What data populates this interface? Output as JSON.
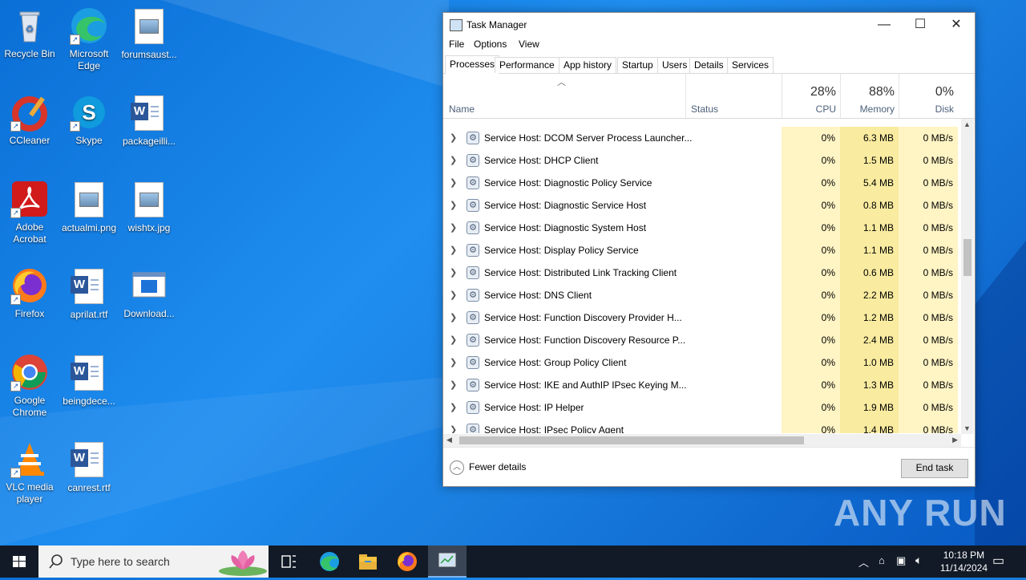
{
  "desktop": {
    "icons": [
      {
        "label": "Recycle Bin"
      },
      {
        "label": "Microsoft Edge"
      },
      {
        "label": "forumsaust..."
      },
      {
        "label": "CCleaner"
      },
      {
        "label": "Skype"
      },
      {
        "label": "packageilli..."
      },
      {
        "label": "Adobe Acrobat"
      },
      {
        "label": "actualmi.png"
      },
      {
        "label": "wishtx.jpg"
      },
      {
        "label": "Firefox"
      },
      {
        "label": "aprilat.rtf"
      },
      {
        "label": "Download..."
      },
      {
        "label": "Google Chrome"
      },
      {
        "label": "beingdece..."
      },
      {
        "label": "VLC media player"
      },
      {
        "label": "canrest.rtf"
      }
    ]
  },
  "taskmgr": {
    "title": "Task Manager",
    "menu": [
      "File",
      "Options",
      "View"
    ],
    "tabs": [
      "Processes",
      "Performance",
      "App history",
      "Startup",
      "Users",
      "Details",
      "Services"
    ],
    "active_tab": "Processes",
    "columns": {
      "name": "Name",
      "status": "Status",
      "cpu": {
        "pct": "28%",
        "label": "CPU"
      },
      "memory": {
        "pct": "88%",
        "label": "Memory"
      },
      "disk": {
        "pct": "0%",
        "label": "Disk"
      }
    },
    "rows": [
      {
        "name": "Service Host: DCOM Server Process Launcher...",
        "cpu": "0%",
        "mem": "6.3 MB",
        "disk": "0 MB/s"
      },
      {
        "name": "Service Host: DHCP Client",
        "cpu": "0%",
        "mem": "1.5 MB",
        "disk": "0 MB/s"
      },
      {
        "name": "Service Host: Diagnostic Policy Service",
        "cpu": "0%",
        "mem": "5.4 MB",
        "disk": "0 MB/s"
      },
      {
        "name": "Service Host: Diagnostic Service Host",
        "cpu": "0%",
        "mem": "0.8 MB",
        "disk": "0 MB/s"
      },
      {
        "name": "Service Host: Diagnostic System Host",
        "cpu": "0%",
        "mem": "1.1 MB",
        "disk": "0 MB/s"
      },
      {
        "name": "Service Host: Display Policy Service",
        "cpu": "0%",
        "mem": "1.1 MB",
        "disk": "0 MB/s"
      },
      {
        "name": "Service Host: Distributed Link Tracking Client",
        "cpu": "0%",
        "mem": "0.6 MB",
        "disk": "0 MB/s"
      },
      {
        "name": "Service Host: DNS Client",
        "cpu": "0%",
        "mem": "2.2 MB",
        "disk": "0 MB/s"
      },
      {
        "name": "Service Host: Function Discovery Provider H...",
        "cpu": "0%",
        "mem": "1.2 MB",
        "disk": "0 MB/s"
      },
      {
        "name": "Service Host: Function Discovery Resource P...",
        "cpu": "0%",
        "mem": "2.4 MB",
        "disk": "0 MB/s"
      },
      {
        "name": "Service Host: Group Policy Client",
        "cpu": "0%",
        "mem": "1.0 MB",
        "disk": "0 MB/s"
      },
      {
        "name": "Service Host: IKE and AuthIP IPsec Keying M...",
        "cpu": "0%",
        "mem": "1.3 MB",
        "disk": "0 MB/s"
      },
      {
        "name": "Service Host: IP Helper",
        "cpu": "0%",
        "mem": "1.9 MB",
        "disk": "0 MB/s"
      },
      {
        "name": "Service Host: IPsec Policy Agent",
        "cpu": "0%",
        "mem": "1.4 MB",
        "disk": "0 MB/s"
      }
    ],
    "fewer_details": "Fewer details",
    "end_task": "End task"
  },
  "taskbar": {
    "search_placeholder": "Type here to search",
    "time": "10:18 PM",
    "date": "11/14/2024"
  },
  "watermark": "ANY RUN",
  "colors": {
    "desktop": "#1a7fe0",
    "taskbar": "#111a26",
    "cpu_cell": "#fff4c4",
    "mem_cell": "#f9eba0"
  }
}
